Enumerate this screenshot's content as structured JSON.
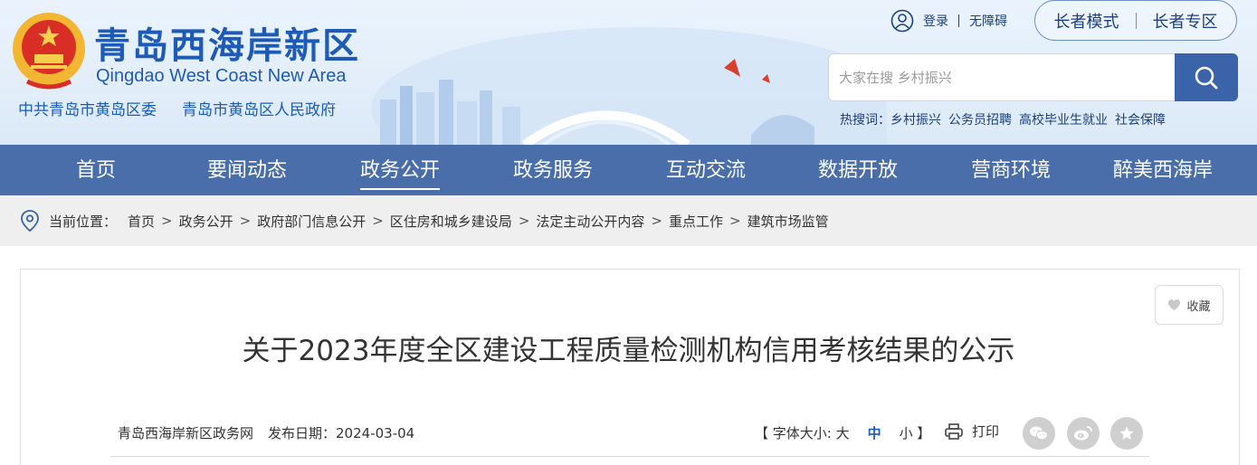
{
  "header": {
    "site_title": "青岛西海岸新区",
    "site_subtitle": "Qingdao West Coast New Area",
    "org_party": "中共青岛市黄岛区委",
    "org_gov": "青岛市黄岛区人民政府",
    "login": "登录",
    "accessibility": "无障碍",
    "elder_mode": "长者模式",
    "elder_zone": "长者专区",
    "search_placeholder": "大家在搜 乡村振兴",
    "hot_label": "热搜词：",
    "hot_words": [
      "乡村振兴",
      "公务员招聘",
      "高校毕业生就业",
      "社会保障"
    ]
  },
  "nav": {
    "items": [
      "首页",
      "要闻动态",
      "政务公开",
      "政务服务",
      "互动交流",
      "数据开放",
      "营商环境",
      "醉美西海岸"
    ],
    "active": "政务公开"
  },
  "breadcrumb": {
    "label": "当前位置：",
    "items": [
      "首页",
      "政务公开",
      "政府部门信息公开",
      "区住房和城乡建设局",
      "法定主动公开内容",
      "重点工作",
      "建筑市场监管"
    ]
  },
  "article": {
    "collect": "收藏",
    "title": "关于2023年度全区建设工程质量检测机构信用考核结果的公示",
    "source": "青岛西海岸新区政务网",
    "date_label": "发布日期：2024-03-04",
    "font_size_label": "【 字体大小: 大",
    "font_mid": "中",
    "font_small": "小 】",
    "print": "打印"
  },
  "colors": {
    "brand_blue": "#1d5bb6",
    "nav_bg": "#4a6ea9",
    "search_btn": "#3a63a9"
  },
  "icons": [
    "emblem-icon",
    "user-icon",
    "search-icon",
    "location-icon",
    "heart-icon",
    "print-icon",
    "wechat-icon",
    "weibo-icon",
    "star-icon"
  ]
}
